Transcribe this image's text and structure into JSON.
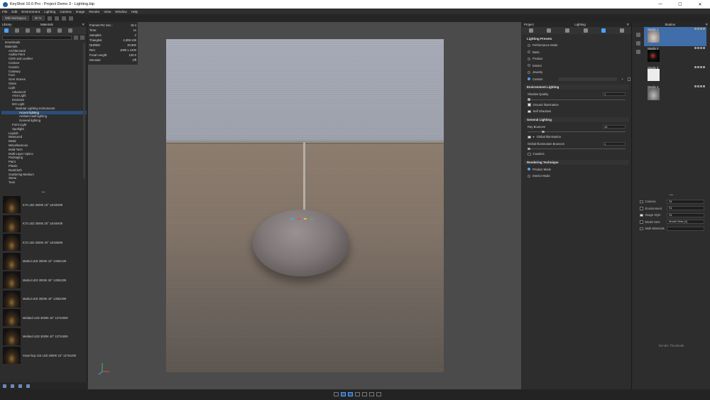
{
  "window": {
    "title": "KeyShot 10.0 Pro - Project Demo 3 - Lighting.bip",
    "buttons": [
      "—",
      "☐",
      "✕"
    ]
  },
  "menu": [
    "File",
    "Edit",
    "Environment",
    "Lighting",
    "Camera",
    "Image",
    "Render",
    "View",
    "Window",
    "Help"
  ],
  "toolbar": {
    "workspace": "Wiki Workspace",
    "zoom": "50 %"
  },
  "library": {
    "panel_title": "Library",
    "tab_title": "Materials",
    "tree": [
      {
        "label": "Downloads",
        "indent": 1
      },
      {
        "label": "Materials",
        "indent": 1
      },
      {
        "label": "Architectural",
        "indent": 2
      },
      {
        "label": "Axalta Paint",
        "indent": 2
      },
      {
        "label": "Cloth and Leather",
        "indent": 2
      },
      {
        "label": "Contour",
        "indent": 2
      },
      {
        "label": "Custom",
        "indent": 2
      },
      {
        "label": "Cutaway",
        "indent": 2
      },
      {
        "label": "Fuzz",
        "indent": 2
      },
      {
        "label": "Gem Stones",
        "indent": 2
      },
      {
        "label": "Glass",
        "indent": 2
      },
      {
        "label": "Light",
        "indent": 2
      },
      {
        "label": "Advanced",
        "indent": 3
      },
      {
        "label": "Area Light",
        "indent": 3
      },
      {
        "label": "Emissive",
        "indent": 3
      },
      {
        "label": "IES Light",
        "indent": 3
      },
      {
        "label": "Modular Lighting Instruments",
        "indent": 4
      },
      {
        "label": "Accent lighting",
        "indent": 5,
        "selected": true
      },
      {
        "label": "Ambient wall lighting",
        "indent": 5
      },
      {
        "label": "General lighting",
        "indent": 5
      },
      {
        "label": "Point Light",
        "indent": 3
      },
      {
        "label": "Spotlight",
        "indent": 3
      },
      {
        "label": "Liquids",
        "indent": 2
      },
      {
        "label": "Measured",
        "indent": 2
      },
      {
        "label": "Metal",
        "indent": 2
      },
      {
        "label": "Miscellaneous",
        "indent": 2
      },
      {
        "label": "Mold-Tech",
        "indent": 2
      },
      {
        "label": "Multi-Layer Optics",
        "indent": 2
      },
      {
        "label": "Packaging",
        "indent": 2
      },
      {
        "label": "Paint",
        "indent": 2
      },
      {
        "label": "Plastic",
        "indent": 2
      },
      {
        "label": "RealCloth",
        "indent": 2
      },
      {
        "label": "Scattering Medium",
        "indent": 2
      },
      {
        "label": "Stone",
        "indent": 2
      },
      {
        "label": "Toon",
        "indent": 2
      }
    ],
    "thumbnails": [
      "K72 LED 3000K 15° 14040309",
      "K72 LED 3000K 25° 14040409",
      "K72 LED 3000K 40° 14040509",
      "Marbul LED 3000K 10° 13052109",
      "Marbul LED 3000K 25° 13052209",
      "Marbul LED 3000K 40° 13052309",
      "Meldard LED 3000K 25° 12734009",
      "Meldard LED 3000K 40° 12734009",
      "Smart kup 115 LED 3000K 15° 12761409"
    ]
  },
  "stats": [
    {
      "k": "Frames Per Sec.:",
      "v": "18.4"
    },
    {
      "k": "Time:",
      "v": "1s"
    },
    {
      "k": "Samples:",
      "v": "2"
    },
    {
      "k": "Triangles:",
      "v": "4,308,136"
    },
    {
      "k": "NURBS:",
      "v": "20,992"
    },
    {
      "k": "Res:",
      "v": "1000 x 1200"
    },
    {
      "k": "Focal Length:",
      "v": "120.0"
    },
    {
      "k": "Denoise:",
      "v": "Off"
    }
  ],
  "lighting": {
    "header_left": "Project",
    "header_center": "Lighting",
    "presets_title": "Lighting Presets",
    "presets": [
      "Performance Mode",
      "Basic",
      "Product",
      "Interior",
      "Jewelry",
      "Custom"
    ],
    "selected_preset": "Custom",
    "env_title": "Environment Lighting",
    "shadow_quality_label": "Shadow Quality",
    "shadow_quality_value": "1",
    "ground_illumination": "Ground Illumination",
    "self_shadows": "Self Shadows",
    "general_title": "General Lighting",
    "ray_bounces_label": "Ray Bounces",
    "ray_bounces_value": "10",
    "global_illumination": "Global Illumination",
    "gi_bounces_label": "Global Illumination Bounces",
    "gi_bounces_value": "1",
    "caustics": "Caustics",
    "technique_title": "Rendering Technique",
    "techniques": [
      "Product Mode",
      "Interior Mode"
    ],
    "selected_technique": "Product Mode"
  },
  "studios": {
    "title": "Studios",
    "items": [
      "Studio 1",
      "Studio 2",
      "Studio 3",
      "Studio 4"
    ],
    "props": [
      {
        "label": "Camera",
        "value": "S1",
        "checked": false
      },
      {
        "label": "Environment",
        "value": "S1",
        "checked": false
      },
      {
        "label": "Image Style",
        "value": "S1",
        "checked": true
      },
      {
        "label": "Model Sets",
        "value": "Model Sets (4)",
        "checked": false
      },
      {
        "label": "Multi-Materials",
        "value": "",
        "checked": false
      }
    ],
    "render_thumbnail": "Render Thumbnail"
  }
}
